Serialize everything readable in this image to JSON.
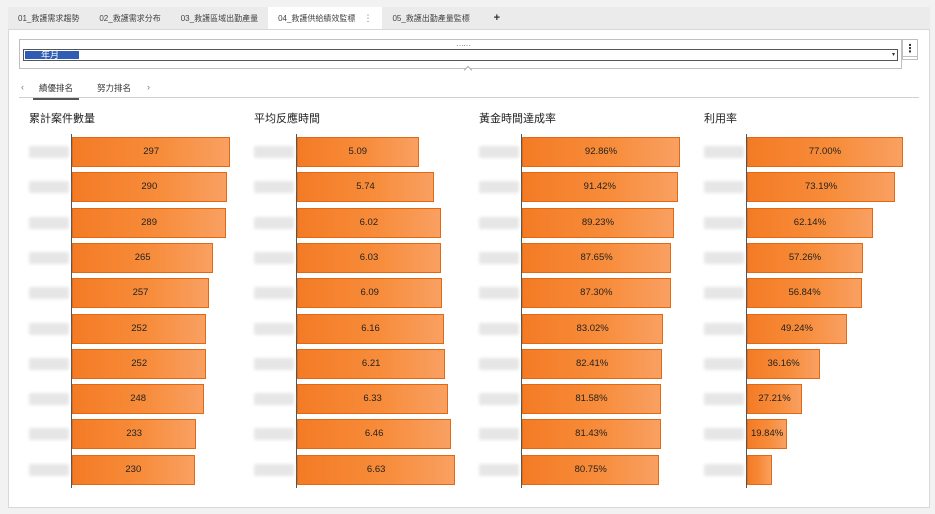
{
  "tabs": [
    {
      "label": "01_救護需求趨勢",
      "active": false
    },
    {
      "label": "02_救護需求分布",
      "active": false
    },
    {
      "label": "03_救護區域出勤產量",
      "active": false
    },
    {
      "label": "04_救護供給績效監標",
      "active": true
    },
    {
      "label": "05_救護出勤產量監標",
      "active": false
    }
  ],
  "add_tab_label": "+",
  "filter": {
    "value": "年月",
    "caret": "▾",
    "menu_icon": "⋮",
    "grip": "⋯⋯"
  },
  "subtabs": {
    "prev": "‹",
    "next": "›",
    "items": [
      {
        "label": "績優排名",
        "active": true
      },
      {
        "label": "努力排名",
        "active": false
      }
    ]
  },
  "accent_color": "#f47b25",
  "chart_data": [
    {
      "type": "bar",
      "title": "累計案件數量",
      "values": [
        297,
        290,
        289,
        265,
        257,
        252,
        252,
        248,
        233,
        230
      ],
      "labels": [
        "297",
        "290",
        "289",
        "265",
        "257",
        "252",
        "252",
        "248",
        "233",
        "230"
      ],
      "xlim": [
        0,
        300
      ]
    },
    {
      "type": "bar",
      "title": "平均反應時間",
      "values": [
        5.09,
        5.74,
        6.02,
        6.03,
        6.09,
        6.16,
        6.21,
        6.33,
        6.46,
        6.63
      ],
      "labels": [
        "5.09",
        "5.74",
        "6.02",
        "6.03",
        "6.09",
        "6.16",
        "6.21",
        "6.33",
        "6.46",
        "6.63"
      ],
      "xlim": [
        0,
        6.7
      ]
    },
    {
      "type": "bar",
      "title": "黃金時間達成率",
      "values": [
        92.86,
        91.42,
        89.23,
        87.65,
        87.3,
        83.02,
        82.41,
        81.58,
        81.43,
        80.75
      ],
      "labels": [
        "92.86%",
        "91.42%",
        "89.23%",
        "87.65%",
        "87.30%",
        "83.02%",
        "82.41%",
        "81.58%",
        "81.43%",
        "80.75%"
      ],
      "xlim": [
        0,
        94
      ]
    },
    {
      "type": "bar",
      "title": "利用率",
      "values": [
        77.0,
        73.19,
        62.14,
        57.26,
        56.84,
        49.24,
        36.16,
        27.21,
        19.84,
        12.5
      ],
      "labels": [
        "77.00%",
        "73.19%",
        "62.14%",
        "57.26%",
        "56.84%",
        "49.24%",
        "36.16%",
        "27.21%",
        "19.84%",
        ""
      ],
      "xlim": [
        0,
        79
      ]
    }
  ]
}
